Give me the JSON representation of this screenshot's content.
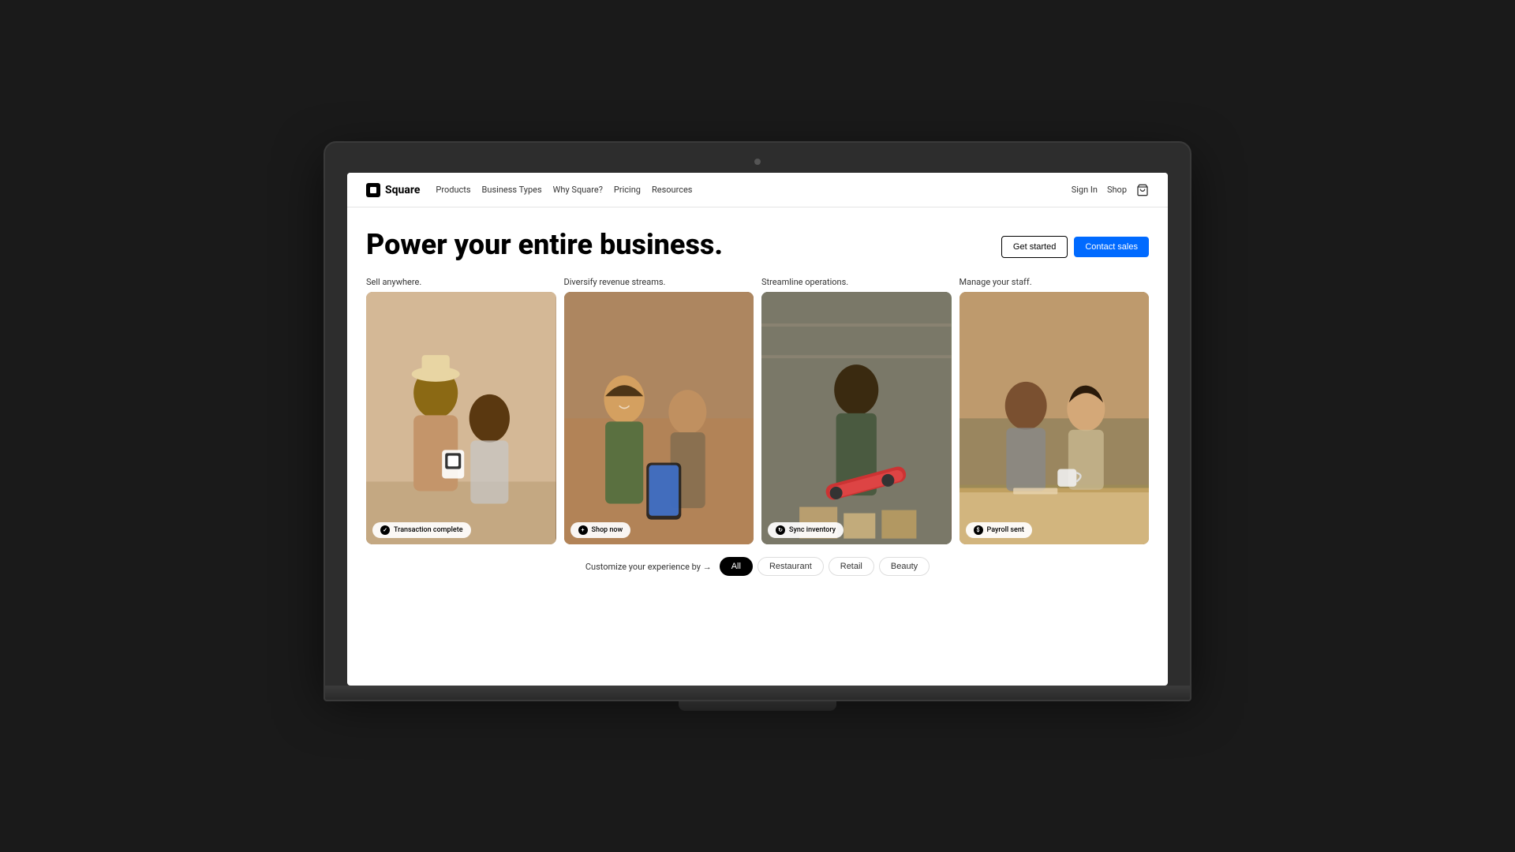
{
  "laptop": {
    "camera_label": "camera"
  },
  "nav": {
    "logo_text": "Square",
    "links": [
      {
        "label": "Products",
        "id": "products"
      },
      {
        "label": "Business Types",
        "id": "business-types"
      },
      {
        "label": "Why Square?",
        "id": "why-square"
      },
      {
        "label": "Pricing",
        "id": "pricing"
      },
      {
        "label": "Resources",
        "id": "resources"
      }
    ],
    "sign_in": "Sign In",
    "shop": "Shop",
    "cart_label": "shopping-cart"
  },
  "hero": {
    "title": "Power your entire business.",
    "get_started": "Get started",
    "contact_sales": "Contact sales"
  },
  "cards": [
    {
      "label": "Sell anywhere.",
      "overlay": "Transaction complete",
      "overlay_icon": "check"
    },
    {
      "label": "Diversify revenue streams.",
      "overlay": "Shop now",
      "overlay_icon": "plus"
    },
    {
      "label": "Streamline operations.",
      "overlay": "Sync inventory",
      "overlay_icon": "sync"
    },
    {
      "label": "Manage your staff.",
      "overlay": "Payroll sent",
      "overlay_icon": "payroll"
    }
  ],
  "filter": {
    "label": "Customize your experience by →",
    "pills": [
      {
        "label": "All",
        "active": true
      },
      {
        "label": "Restaurant",
        "active": false
      },
      {
        "label": "Retail",
        "active": false
      },
      {
        "label": "Beauty",
        "active": false
      }
    ]
  }
}
